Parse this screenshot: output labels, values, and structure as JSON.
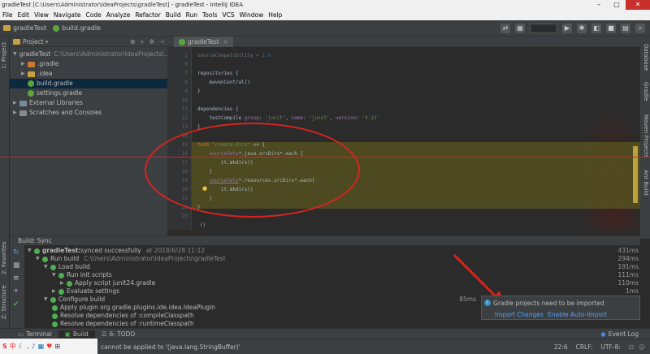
{
  "window": {
    "title_app": "gradleTest",
    "title_path": "[C:\\Users\\Administrator\\IdeaProjects\\gradleTest]",
    "title_rest": "- gradleTest - IntelliJ IDEA"
  },
  "menu": [
    "File",
    "Edit",
    "View",
    "Navigate",
    "Code",
    "Analyze",
    "Refactor",
    "Build",
    "Run",
    "Tools",
    "VCS",
    "Window",
    "Help"
  ],
  "navbar": {
    "project": "gradleTest",
    "file": "build.gradle"
  },
  "project_panel": {
    "header": "Project",
    "tree": [
      {
        "label": "gradleTest",
        "muted": "C:\\Users\\Administrator\\IdeaProjects\\..."
      },
      {
        "label": ".gradle"
      },
      {
        "label": ".idea"
      },
      {
        "label": "build.gradle"
      },
      {
        "label": "settings.gradle"
      },
      {
        "label": "External Libraries"
      },
      {
        "label": "Scratches and Consoles"
      }
    ]
  },
  "editor": {
    "tab": "gradleTest",
    "line_numbers": [
      "5",
      "6",
      "7",
      "8",
      "9",
      "10",
      "11",
      "12",
      "13",
      "14",
      "15",
      "16",
      "17",
      "18",
      "19",
      "20",
      "21",
      "22",
      "23"
    ],
    "footer": "()"
  },
  "left_tool_tabs": [
    "1: Project",
    "2: Favorites",
    "Z: Structure"
  ],
  "right_tool_tabs": [
    "Database",
    "Gradle",
    "Maven Projects",
    "Ant Build"
  ],
  "build": {
    "header": "Build: Sync",
    "rows": [
      {
        "label": "gradleTest:",
        "rest": " synced successfully",
        "extra": "at 2018/6/28 11:12",
        "time": "431ms"
      },
      {
        "label": "Run build",
        "extra": "C:\\Users\\Administrator\\IdeaProjects\\gradleTest",
        "time": "294ms"
      },
      {
        "label": "Load build",
        "time": "191ms"
      },
      {
        "label": "Run init scripts",
        "time": "111ms"
      },
      {
        "label": "Apply script junit24.gradle",
        "time": "110ms"
      },
      {
        "label": "Evaluate settings",
        "time": "1ms"
      },
      {
        "label": "Configure build",
        "time": "85ms"
      },
      {
        "label": "Apply plugin org.gradle.plugins.ide.idea.IdeaPlugin",
        "time": ""
      },
      {
        "label": "Resolve dependencies of :compileClasspath",
        "time": ""
      },
      {
        "label": "Resolve dependencies of :runtimeClasspath",
        "time": ""
      }
    ]
  },
  "bottom_tabs": [
    "Terminal",
    "Build",
    "6: TODO"
  ],
  "event_log": "Event Log",
  "status": {
    "message": "cannot be applied to '(java.lang.StringBuffer)'",
    "position": "22:6",
    "line_sep": "CRLF:",
    "encoding": "UTF-8:"
  },
  "notification": {
    "title": "Gradle projects need to be imported",
    "link1": "Import Changes",
    "link2": "Enable Auto-Import"
  }
}
